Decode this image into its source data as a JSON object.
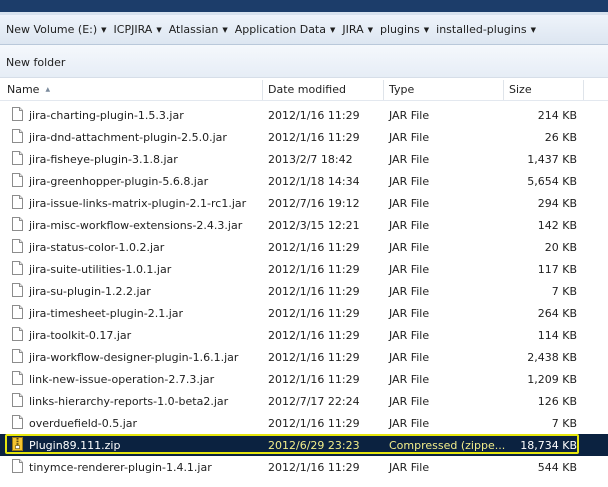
{
  "breadcrumb": [
    {
      "label": "New Volume (E:)"
    },
    {
      "label": "ICPJIRA"
    },
    {
      "label": "Atlassian"
    },
    {
      "label": "Application Data"
    },
    {
      "label": "JIRA"
    },
    {
      "label": "plugins"
    },
    {
      "label": "installed-plugins"
    }
  ],
  "toolbar": {
    "new_folder_label": "New folder"
  },
  "columns": {
    "name": "Name",
    "date": "Date modified",
    "type": "Type",
    "size": "Size"
  },
  "files": [
    {
      "name": "jira-charting-plugin-1.5.3.jar",
      "date": "2012/1/16 11:29",
      "type": "JAR File",
      "size": "214 KB",
      "icon": "jar-file-icon",
      "selected": false
    },
    {
      "name": "jira-dnd-attachment-plugin-2.5.0.jar",
      "date": "2012/1/16 11:29",
      "type": "JAR File",
      "size": "26 KB",
      "icon": "jar-file-icon",
      "selected": false
    },
    {
      "name": "jira-fisheye-plugin-3.1.8.jar",
      "date": "2013/2/7 18:42",
      "type": "JAR File",
      "size": "1,437 KB",
      "icon": "jar-file-icon",
      "selected": false
    },
    {
      "name": "jira-greenhopper-plugin-5.6.8.jar",
      "date": "2012/1/18 14:34",
      "type": "JAR File",
      "size": "5,654 KB",
      "icon": "jar-file-icon",
      "selected": false
    },
    {
      "name": "jira-issue-links-matrix-plugin-2.1-rc1.jar",
      "date": "2012/7/16 19:12",
      "type": "JAR File",
      "size": "294 KB",
      "icon": "jar-file-icon",
      "selected": false
    },
    {
      "name": "jira-misc-workflow-extensions-2.4.3.jar",
      "date": "2012/3/15 12:21",
      "type": "JAR File",
      "size": "142 KB",
      "icon": "jar-file-icon",
      "selected": false
    },
    {
      "name": "jira-status-color-1.0.2.jar",
      "date": "2012/1/16 11:29",
      "type": "JAR File",
      "size": "20 KB",
      "icon": "jar-file-icon",
      "selected": false
    },
    {
      "name": "jira-suite-utilities-1.0.1.jar",
      "date": "2012/1/16 11:29",
      "type": "JAR File",
      "size": "117 KB",
      "icon": "jar-file-icon",
      "selected": false
    },
    {
      "name": "jira-su-plugin-1.2.2.jar",
      "date": "2012/1/16 11:29",
      "type": "JAR File",
      "size": "7 KB",
      "icon": "jar-file-icon",
      "selected": false
    },
    {
      "name": "jira-timesheet-plugin-2.1.jar",
      "date": "2012/1/16 11:29",
      "type": "JAR File",
      "size": "264 KB",
      "icon": "jar-file-icon",
      "selected": false
    },
    {
      "name": "jira-toolkit-0.17.jar",
      "date": "2012/1/16 11:29",
      "type": "JAR File",
      "size": "114 KB",
      "icon": "jar-file-icon",
      "selected": false
    },
    {
      "name": "jira-workflow-designer-plugin-1.6.1.jar",
      "date": "2012/1/16 11:29",
      "type": "JAR File",
      "size": "2,438 KB",
      "icon": "jar-file-icon",
      "selected": false
    },
    {
      "name": "link-new-issue-operation-2.7.3.jar",
      "date": "2012/1/16 11:29",
      "type": "JAR File",
      "size": "1,209 KB",
      "icon": "jar-file-icon",
      "selected": false
    },
    {
      "name": "links-hierarchy-reports-1.0-beta2.jar",
      "date": "2012/7/17 22:24",
      "type": "JAR File",
      "size": "126 KB",
      "icon": "jar-file-icon",
      "selected": false
    },
    {
      "name": "overduefield-0.5.jar",
      "date": "2012/1/16 11:29",
      "type": "JAR File",
      "size": "7 KB",
      "icon": "jar-file-icon",
      "selected": false
    },
    {
      "name": "Plugin89.111.zip",
      "date": "2012/6/29 23:23",
      "type": "Compressed (zippe...",
      "size": "18,734 KB",
      "icon": "zip-folder-icon",
      "selected": true
    },
    {
      "name": "tinymce-renderer-plugin-1.4.1.jar",
      "date": "2012/1/16 11:29",
      "type": "JAR File",
      "size": "544 KB",
      "icon": "jar-file-icon",
      "selected": false
    }
  ],
  "colors": {
    "title_bar": "#1c3d6a",
    "selection_bg": "#0b2240",
    "selection_border": "#e5e50e"
  }
}
